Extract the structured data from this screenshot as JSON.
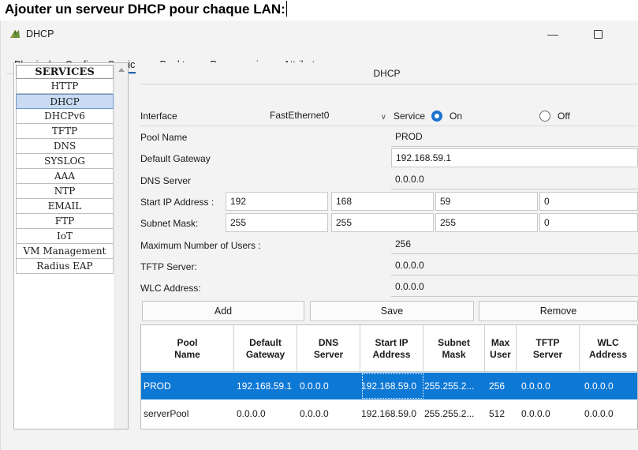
{
  "caption": "Ajouter un serveur DHCP pour chaque LAN:",
  "window": {
    "title": "DHCP",
    "minimize_glyph": "—",
    "app_icon": "router-icon"
  },
  "tabs": [
    "Physical",
    "Config",
    "Services",
    "Desktop",
    "Programming",
    "Attributes"
  ],
  "active_tab": "Services",
  "services": {
    "header": "SERVICES",
    "items": [
      "HTTP",
      "DHCP",
      "DHCPv6",
      "TFTP",
      "DNS",
      "SYSLOG",
      "AAA",
      "NTP",
      "EMAIL",
      "FTP",
      "IoT",
      "VM Management",
      "Radius EAP"
    ],
    "selected": "DHCP"
  },
  "form": {
    "title": "DHCP",
    "interface_label": "Interface",
    "interface_value": "FastEthernet0",
    "service_label": "Service",
    "on_label": "On",
    "off_label": "Off",
    "service_state": "On",
    "pool_name_label": "Pool Name",
    "pool_name": "PROD",
    "gateway_label": "Default Gateway",
    "gateway": "192.168.59.1",
    "dns_label": "DNS Server",
    "dns": "0.0.0.0",
    "start_ip_label": "Start IP Address :",
    "start_ip": [
      "192",
      "168",
      "59",
      "0"
    ],
    "subnet_label": "Subnet Mask:",
    "subnet": [
      "255",
      "255",
      "255",
      "0"
    ],
    "max_users_label": "Maximum Number of Users :",
    "max_users": "256",
    "tftp_label": "TFTP Server:",
    "tftp": "0.0.0.0",
    "wlc_label": "WLC Address:",
    "wlc": "0.0.0.0"
  },
  "buttons": {
    "add": "Add",
    "save": "Save",
    "remove": "Remove"
  },
  "table": {
    "columns": [
      "Pool Name",
      "Default Gateway",
      "DNS Server",
      "Start IP Address",
      "Subnet Mask",
      "Max User",
      "TFTP Server",
      "WLC Address"
    ],
    "rows": [
      [
        "PROD",
        "192.168.59.1",
        "0.0.0.0",
        "192.168.59.0",
        "255.255.2...",
        "256",
        "0.0.0.0",
        "0.0.0.0"
      ],
      [
        "serverPool",
        "0.0.0.0",
        "0.0.0.0",
        "192.168.59.0",
        "255.255.2...",
        "512",
        "0.0.0.0",
        "0.0.0.0"
      ]
    ],
    "selected_row": 0
  },
  "colors": {
    "accent": "#0e78d5",
    "selection_light": "#c8dbf2"
  }
}
